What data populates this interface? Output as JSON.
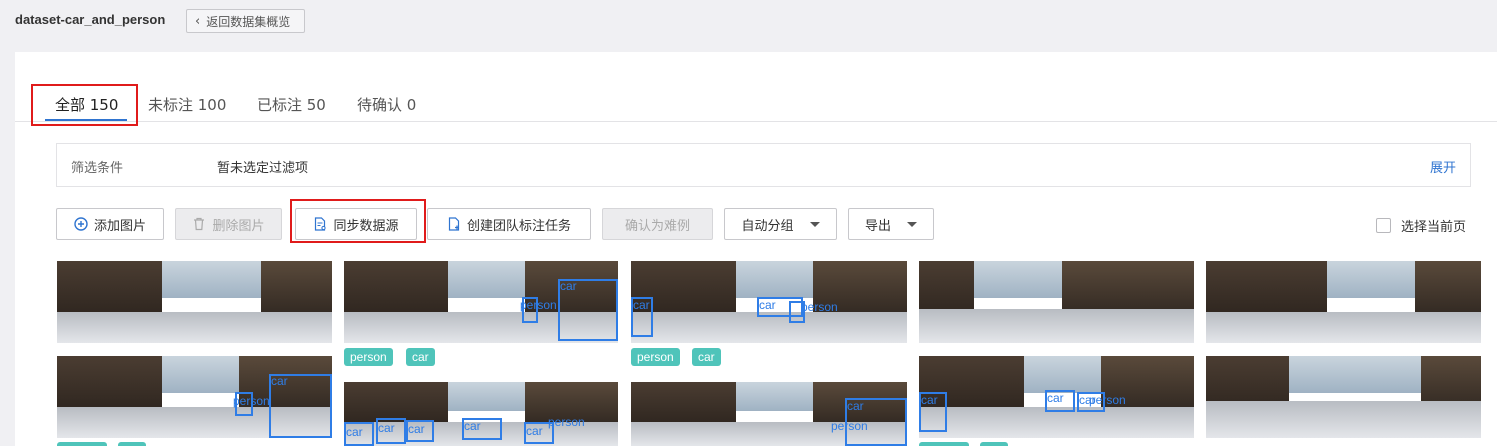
{
  "header": {
    "dataset_name": "dataset-car_and_person",
    "back_label": "返回数据集概览"
  },
  "tabs": [
    {
      "label": "全部 150",
      "active": true
    },
    {
      "label": "未标注 100",
      "active": false
    },
    {
      "label": "已标注 50",
      "active": false
    },
    {
      "label": "待确认 0",
      "active": false
    }
  ],
  "filter": {
    "label": "筛选条件",
    "value": "暂未选定过滤项",
    "expand_label": "展开"
  },
  "toolbar": {
    "add_label": "添加图片",
    "delete_label": "删除图片",
    "sync_label": "同步数据源",
    "create_task_label": "创建团队标注任务",
    "confirm_hard_label": "确认为难例",
    "auto_group_label": "自动分组",
    "export_label": "导出",
    "select_page_label": "选择当前页"
  },
  "images": {
    "row1": [
      {
        "tags": [],
        "boxes": []
      },
      {
        "tags": [
          "person",
          "car"
        ],
        "boxes": [
          "car",
          "person"
        ]
      },
      {
        "tags": [
          "person",
          "car"
        ],
        "boxes": [
          "car",
          "car",
          "person"
        ]
      },
      {
        "tags": [],
        "boxes": []
      },
      {
        "tags": [],
        "boxes": []
      }
    ],
    "row2": [
      {
        "boxes": [
          "car",
          "person"
        ]
      },
      {
        "boxes": [
          "car",
          "car",
          "car",
          "car",
          "car",
          "person"
        ]
      },
      {
        "boxes": [
          "car",
          "person"
        ]
      },
      {
        "boxes": [
          "car",
          "car",
          "car",
          "person"
        ]
      },
      {
        "boxes": []
      }
    ]
  },
  "colors": {
    "accent": "#2f74d0",
    "highlight": "#e01b1b",
    "tag": "#4fc4ba",
    "bbox": "#2f7de6"
  }
}
